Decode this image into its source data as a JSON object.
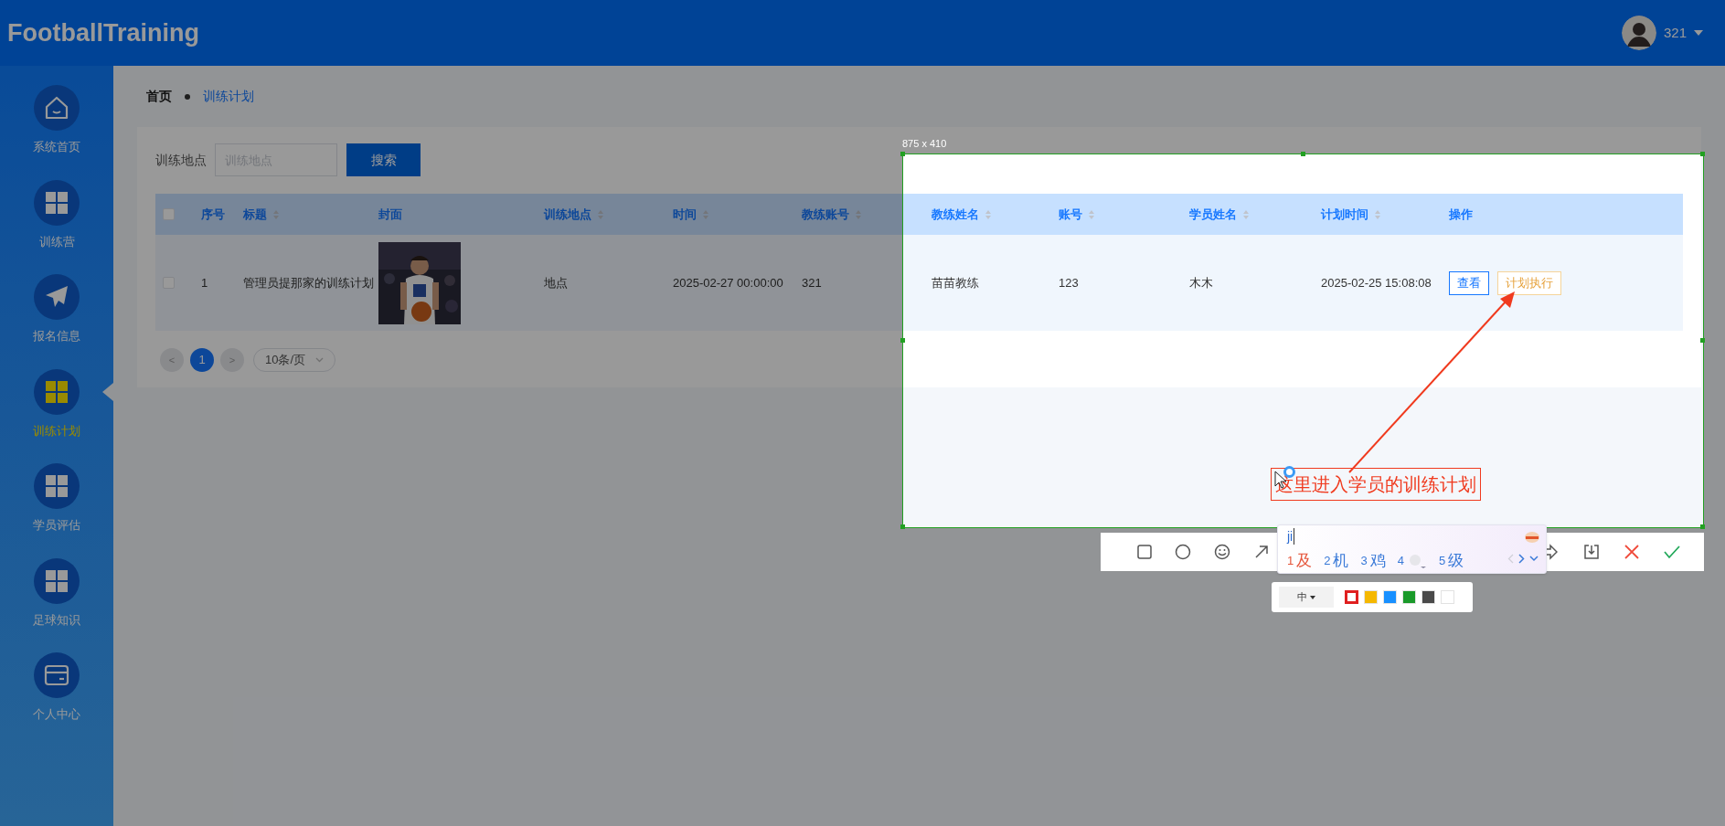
{
  "header": {
    "logo": "FootballTraining",
    "user": "321"
  },
  "sidebar": {
    "items": [
      {
        "label": "系统首页",
        "kind": "home",
        "selected": false
      },
      {
        "label": "训练营",
        "kind": "grid",
        "selected": false
      },
      {
        "label": "报名信息",
        "kind": "plane",
        "selected": false
      },
      {
        "label": "训练计划",
        "kind": "grid",
        "selected": true
      },
      {
        "label": "学员评估",
        "kind": "grid",
        "selected": false
      },
      {
        "label": "足球知识",
        "kind": "grid",
        "selected": false
      },
      {
        "label": "个人中心",
        "kind": "card",
        "selected": false
      }
    ]
  },
  "breadcrumb": [
    {
      "label": "首页",
      "selected": false
    },
    {
      "label": "训练计划",
      "selected": true
    }
  ],
  "search": {
    "label": "训练地点",
    "placeholder": "训练地点",
    "button": "搜索"
  },
  "table": {
    "all_checked": false,
    "columns": [
      {
        "label": "序号",
        "sortable": false
      },
      {
        "label": "标题",
        "sortable": true
      },
      {
        "label": "封面",
        "sortable": false
      },
      {
        "label": "训练地点",
        "sortable": true
      },
      {
        "label": "时间",
        "sortable": true
      },
      {
        "label": "教练账号",
        "sortable": true
      },
      {
        "label": "教练姓名",
        "sortable": true
      },
      {
        "label": "账号",
        "sortable": true
      },
      {
        "label": "学员姓名",
        "sortable": true
      },
      {
        "label": "计划时间",
        "sortable": true
      },
      {
        "label": "操作",
        "sortable": false
      }
    ],
    "rows": [
      {
        "checked": false,
        "cells": [
          {
            "kind": "text",
            "text": "1"
          },
          {
            "kind": "text",
            "text": "管理员提那家的训练计划"
          },
          {
            "kind": "picture"
          },
          {
            "kind": "text",
            "text": "地点"
          },
          {
            "kind": "text",
            "text": "2025-02-27 00:00:00"
          },
          {
            "kind": "text",
            "text": "321"
          },
          {
            "kind": "text",
            "text": "苗苗教练"
          },
          {
            "kind": "text",
            "text": "123"
          },
          {
            "kind": "text",
            "text": "木木"
          },
          {
            "kind": "text",
            "text": "2025-02-25 15:08:08"
          },
          {
            "kind": "actions",
            "buttons": [
              {
                "label": "查看",
                "kind": "view"
              },
              {
                "label": "计划执行",
                "kind": "execute"
              }
            ]
          }
        ]
      }
    ]
  },
  "pagination": {
    "prev": "<",
    "pages": [
      {
        "label": "1",
        "selected": true
      }
    ],
    "next": ">",
    "page_size": "10条/页"
  },
  "capture": {
    "size": "875 x 410",
    "annotation": "这里进入学员的训练计划",
    "ime": {
      "input": "ji",
      "candidates": [
        {
          "index": "1",
          "text": "及",
          "selected": true
        },
        {
          "index": "2",
          "text": "机",
          "selected": false
        },
        {
          "index": "3",
          "text": "鸡",
          "selected": false
        },
        {
          "index": "4",
          "kind": "emoji",
          "selected": false
        },
        {
          "index": "5",
          "text": "级",
          "selected": false
        }
      ]
    },
    "style_bar": {
      "size": "中",
      "colors": [
        {
          "color": "#e02020",
          "selected": true
        },
        {
          "color": "#f5b800",
          "selected": false
        },
        {
          "color": "#1890ff",
          "selected": false
        },
        {
          "color": "#1a9a2a",
          "selected": false
        },
        {
          "color": "#4a4a4a",
          "selected": false
        },
        {
          "color": "#ffffff",
          "selected": false
        }
      ]
    }
  }
}
